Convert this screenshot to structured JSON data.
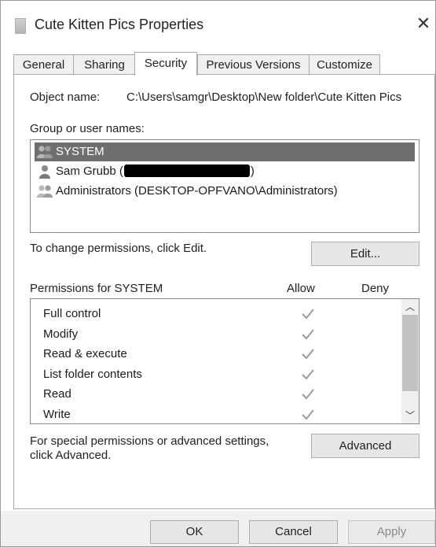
{
  "window": {
    "title": "Cute Kitten Pics Properties"
  },
  "tabs": [
    {
      "label": "General"
    },
    {
      "label": "Sharing"
    },
    {
      "label": "Security"
    },
    {
      "label": "Previous Versions"
    },
    {
      "label": "Customize"
    }
  ],
  "object": {
    "label": "Object name:",
    "value": "C:\\Users\\samgr\\Desktop\\New folder\\Cute Kitten Pics"
  },
  "groups": {
    "label": "Group or user names:",
    "items": [
      {
        "name": "SYSTEM",
        "icon": "users-icon",
        "selected": true
      },
      {
        "name_prefix": "Sam Grubb (",
        "name_suffix": ")",
        "icon": "user-icon"
      },
      {
        "name": "Administrators (DESKTOP-OPFVANO\\Administrators)",
        "icon": "users-icon"
      }
    ]
  },
  "edit": {
    "hint": "To change permissions, click Edit.",
    "button": "Edit..."
  },
  "permissions": {
    "title": "Permissions for SYSTEM",
    "allow_header": "Allow",
    "deny_header": "Deny",
    "items": [
      {
        "name": "Full control",
        "allow": true,
        "deny": false
      },
      {
        "name": "Modify",
        "allow": true,
        "deny": false
      },
      {
        "name": "Read & execute",
        "allow": true,
        "deny": false
      },
      {
        "name": "List folder contents",
        "allow": true,
        "deny": false
      },
      {
        "name": "Read",
        "allow": true,
        "deny": false
      },
      {
        "name": "Write",
        "allow": true,
        "deny": false
      }
    ]
  },
  "advanced": {
    "hint_line1": "For special permissions or advanced settings,",
    "hint_line2": "click Advanced.",
    "button": "Advanced"
  },
  "buttons": {
    "ok": "OK",
    "cancel": "Cancel",
    "apply": "Apply"
  },
  "colors": {
    "selected_row": "#6f6f6f",
    "check": "#9a9a9a"
  }
}
